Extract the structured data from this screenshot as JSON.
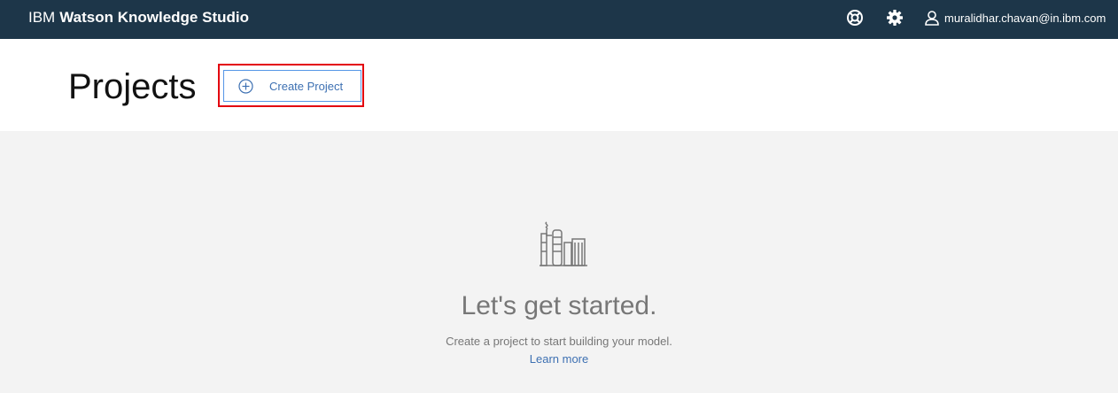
{
  "topbar": {
    "brand_prefix": "IBM",
    "brand_name": "Watson Knowledge Studio",
    "help_icon": "lifebuoy-icon",
    "settings_icon": "gear-icon",
    "user_icon": "user-icon",
    "user_email": "muralidhar.chavan@in.ibm.com",
    "background_color": "#1d3649"
  },
  "header": {
    "title": "Projects",
    "create_button_label": "Create Project",
    "create_button_icon": "add-circle-icon",
    "highlight_color": "#e3000f"
  },
  "empty_state": {
    "icon": "factory-icon",
    "title": "Let's get started.",
    "description": "Create a project to start building your model.",
    "link": "Learn more",
    "link_color": "#3d70b2"
  }
}
